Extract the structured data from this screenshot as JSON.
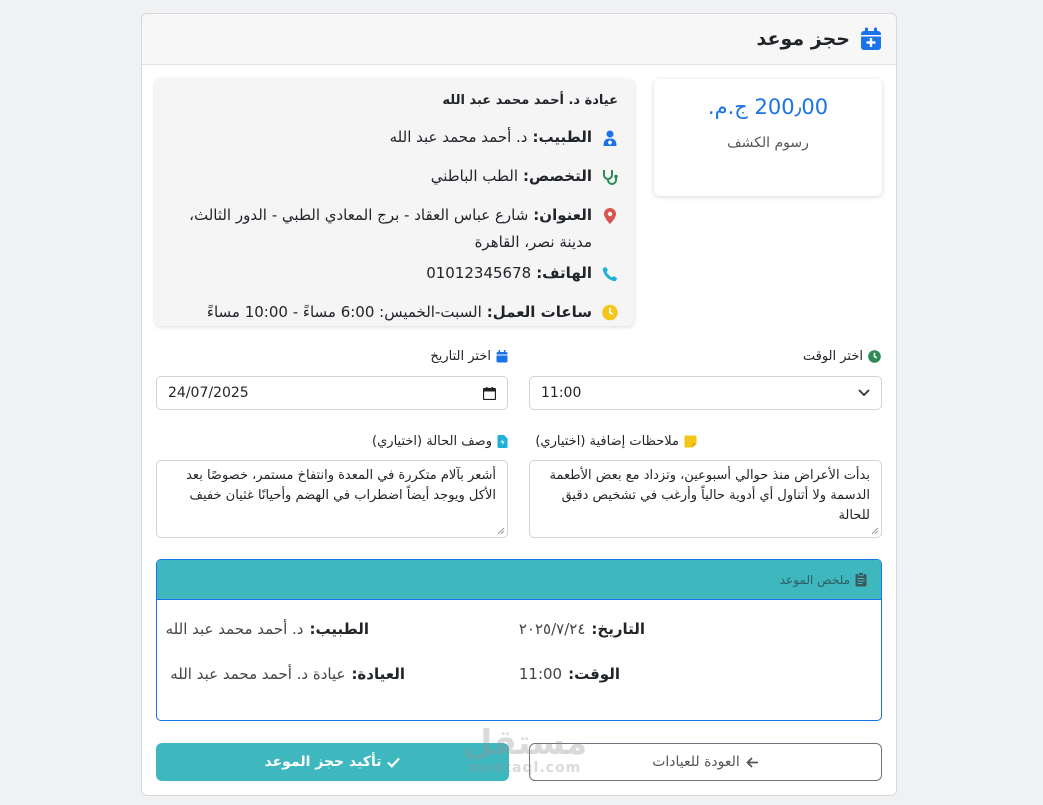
{
  "header": {
    "title": "حجز موعد",
    "icon": "calendar-plus-icon"
  },
  "clinic": {
    "name": "عيادة د. أحمد محمد عبد الله",
    "doctor_label": "الطبيب:",
    "doctor_value": "د. أحمد محمد عبد الله",
    "specialty_label": "التخصص:",
    "specialty_value": "الطب الباطني",
    "address_label": "العنوان:",
    "address_value": "شارع عباس العقاد - برج المعادي الطبي - الدور الثالث،",
    "address_line2": "مدينة نصر، القاهرة",
    "phone_label": "الهاتف:",
    "phone_value": "01012345678",
    "hours_label": "ساعات العمل:",
    "hours_value": "السبت-الخميس: 6:00 مساءً - 10:00 مساءً"
  },
  "fee": {
    "amount": "200٫00 ج.م.",
    "label": "رسوم الكشف"
  },
  "form": {
    "date_label": "اختر التاريخ",
    "date_value": "24/07/2025",
    "time_label": "اختر الوقت",
    "time_value": "11:00",
    "desc_label": "وصف الحالة (اختياري)",
    "desc_value": "أشعر بآلام متكررة في المعدة وانتفاخ مستمر، خصوصًا بعد الأكل ويوجد أيضاً اضطراب في الهضم وأحيانًا غثيان خفيف",
    "notes_label": "ملاحظات إضافية (اختياري)",
    "notes_value": "بدأت الأعراض منذ حوالي أسبوعين، وتزداد مع بعض الأطعمة الدسمة ولا أتناول أي أدوية حالياً وأرغب في تشخيص دقيق للحالة"
  },
  "summary": {
    "title": "ملخص الموعد",
    "date_label": "التاريخ:",
    "date_value": "٢٠٢٥/٧/٢٤",
    "doctor_label": "الطبيب:",
    "doctor_value": "د. أحمد محمد عبد الله",
    "time_label": "الوقت:",
    "time_value": "11:00",
    "clinic_label": "العيادة:",
    "clinic_value": "عيادة د. أحمد محمد عبد الله"
  },
  "buttons": {
    "confirm": "تأكيد حجز الموعد",
    "back": "العودة للعيادات"
  },
  "watermark": {
    "ar": "مستقل",
    "en": "mostaql.com"
  },
  "colors": {
    "primary": "#1a73e8",
    "teal": "#3fb7bf",
    "green": "#2e8b57",
    "location": "#d9534f",
    "amber": "#f5c518"
  }
}
